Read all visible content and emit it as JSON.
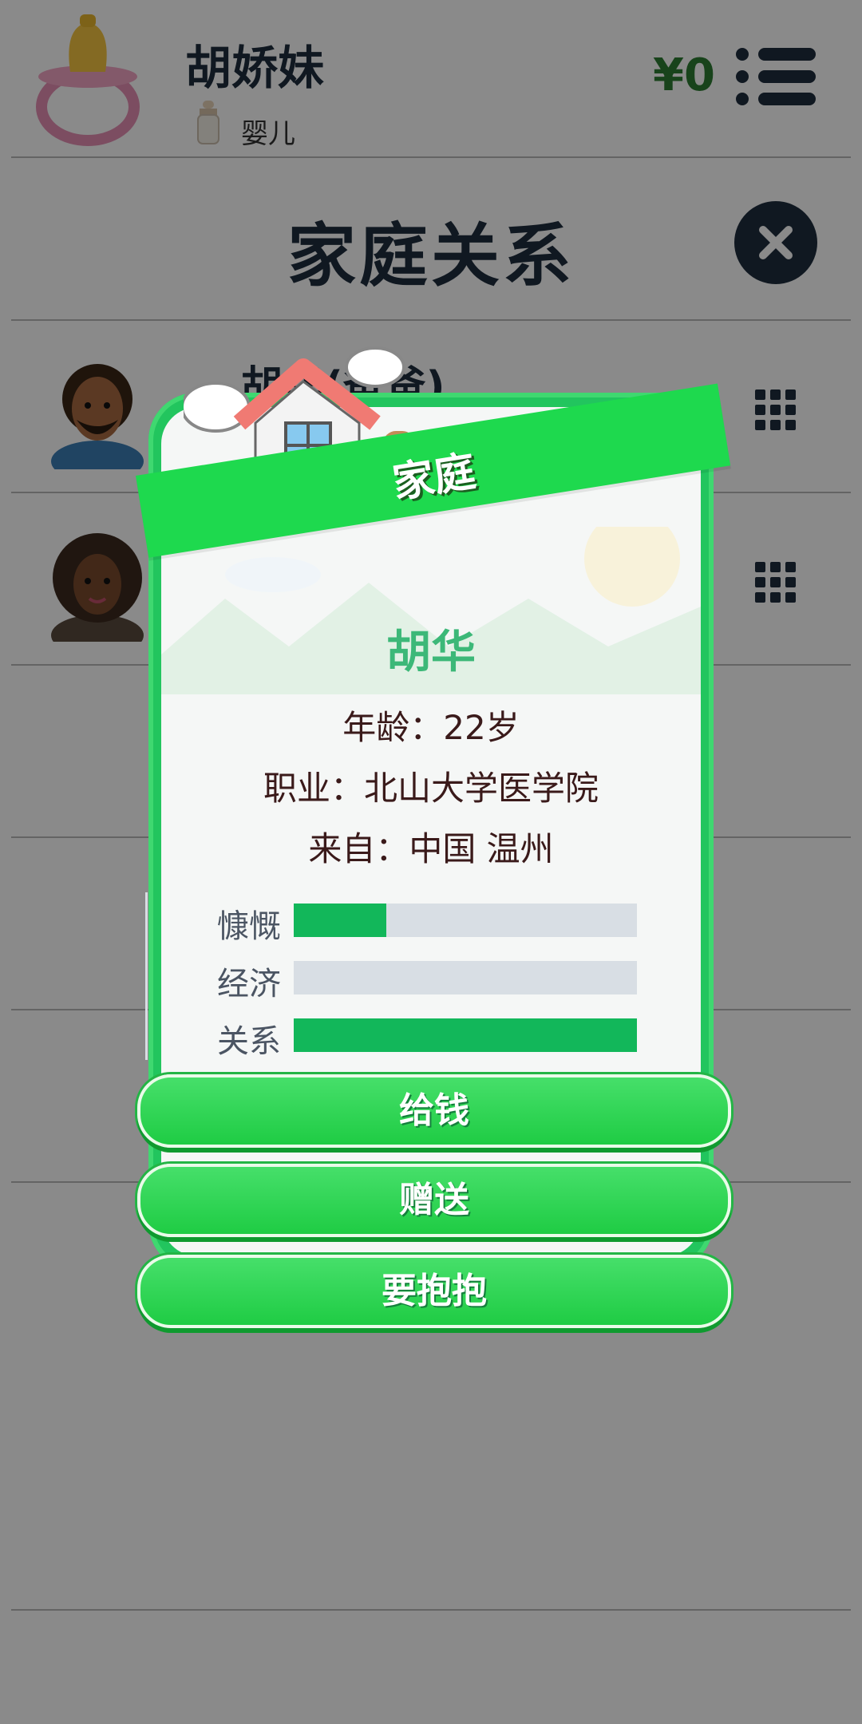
{
  "header": {
    "character_name": "胡娇妹",
    "life_stage": "婴儿",
    "money": "¥0",
    "avatar_icon": "pacifier-icon",
    "stage_icon": "baby-bottle-icon",
    "menu_icon": "list-menu-icon"
  },
  "page": {
    "title": "家庭关系",
    "close_icon": "close-icon"
  },
  "members": [
    {
      "name": "胡华(爸爸)",
      "avatar_icon": "father-avatar-icon",
      "action_icon": "grid-menu-icon"
    },
    {
      "name": "",
      "avatar_icon": "mother-avatar-icon",
      "action_icon": "grid-menu-icon"
    }
  ],
  "modal": {
    "banner": "家庭",
    "banner_icon": "house-icon",
    "person_name": "胡华",
    "age_line": "年龄：22岁",
    "job_line": "职业：北山大学医学院",
    "origin_line": "来自：中国 温州",
    "stats": [
      {
        "label": "慷慨",
        "value": 0.27
      },
      {
        "label": "经济",
        "value": 0.0
      },
      {
        "label": "关系",
        "value": 1.0
      }
    ],
    "buttons": {
      "give_money": "给钱",
      "gift": "赠送",
      "hug": "要抱抱"
    }
  },
  "colors": {
    "modal_green": "#22c55e",
    "ribbon_green": "#1ed94e",
    "stat_fill": "#12b75a",
    "stat_track": "#d8dee4",
    "money_green": "#2e7d32",
    "dark_navy": "#1f2d3d"
  }
}
